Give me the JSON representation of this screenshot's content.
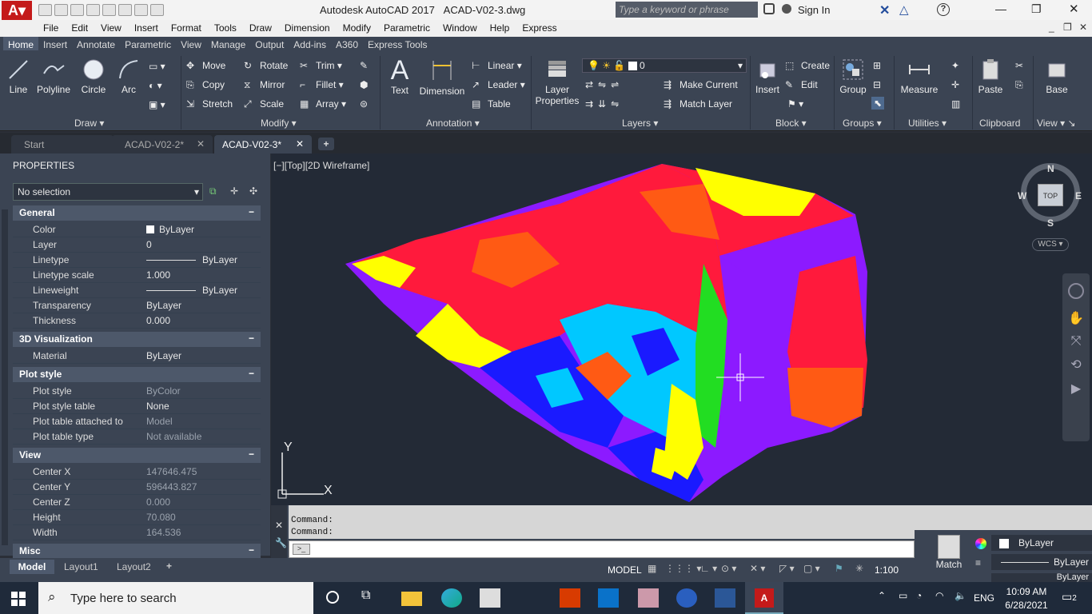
{
  "title": {
    "app": "Autodesk AutoCAD 2017",
    "file": "ACAD-V02-3.dwg",
    "search_placeholder": "Type a keyword or phrase",
    "signin": "Sign In"
  },
  "menu": [
    "File",
    "Edit",
    "View",
    "Insert",
    "Format",
    "Tools",
    "Draw",
    "Dimension",
    "Modify",
    "Parametric",
    "Window",
    "Help",
    "Express"
  ],
  "ribbon_tabs": [
    "Home",
    "Insert",
    "Annotate",
    "Parametric",
    "View",
    "Manage",
    "Output",
    "Add-ins",
    "A360",
    "Express Tools"
  ],
  "draw": {
    "line": "Line",
    "polyline": "Polyline",
    "circle": "Circle",
    "arc": "Arc",
    "panel": "Draw"
  },
  "modify": {
    "move": "Move",
    "rotate": "Rotate",
    "trim": "Trim",
    "copy": "Copy",
    "mirror": "Mirror",
    "fillet": "Fillet",
    "stretch": "Stretch",
    "scale": "Scale",
    "array": "Array",
    "panel": "Modify"
  },
  "annotation": {
    "text": "Text",
    "dimension": "Dimension",
    "linear": "Linear",
    "leader": "Leader",
    "table": "Table",
    "panel": "Annotation"
  },
  "layers": {
    "layer_props": "Layer Properties",
    "current_layer": "0",
    "make_current": "Make Current",
    "match_layer": "Match Layer",
    "panel": "Layers"
  },
  "block": {
    "insert": "Insert",
    "create": "Create",
    "edit": "Edit",
    "panel": "Block"
  },
  "groups": {
    "group": "Group",
    "panel": "Groups"
  },
  "utilities": {
    "measure": "Measure",
    "panel": "Utilities"
  },
  "clipboard": {
    "paste": "Paste",
    "panel": "Clipboard"
  },
  "viewp": {
    "base": "Base",
    "panel": "View"
  },
  "doc_tabs": [
    "Start",
    "ACAD-V02-2*",
    "ACAD-V02-3*"
  ],
  "props": {
    "title": "PROPERTIES",
    "selection": "No selection",
    "general": "General",
    "viz": "3D Visualization",
    "plot": "Plot style",
    "view": "View",
    "misc": "Misc",
    "rows_general": [
      [
        "Color",
        "ByLayer"
      ],
      [
        "Layer",
        "0"
      ],
      [
        "Linetype",
        "ByLayer"
      ],
      [
        "Linetype scale",
        "1.000"
      ],
      [
        "Lineweight",
        "ByLayer"
      ],
      [
        "Transparency",
        "ByLayer"
      ],
      [
        "Thickness",
        "0.000"
      ]
    ],
    "rows_viz": [
      [
        "Material",
        "ByLayer"
      ]
    ],
    "rows_plot": [
      [
        "Plot style",
        "ByColor"
      ],
      [
        "Plot style table",
        "None"
      ],
      [
        "Plot table attached to",
        "Model"
      ],
      [
        "Plot table type",
        "Not available"
      ]
    ],
    "rows_view": [
      [
        "Center X",
        "147646.475"
      ],
      [
        "Center Y",
        "596443.827"
      ],
      [
        "Center Z",
        "0.000"
      ],
      [
        "Height",
        "70.080"
      ],
      [
        "Width",
        "164.536"
      ]
    ]
  },
  "viewport_label": "[−][Top][2D Wireframe]",
  "viewcube": {
    "n": "N",
    "s": "S",
    "e": "E",
    "w": "W",
    "top": "TOP",
    "wcs": "WCS"
  },
  "command": {
    "line1": "Command:",
    "line2": "Command:"
  },
  "layout_tabs": [
    "Model",
    "Layout1",
    "Layout2"
  ],
  "status": {
    "model": "MODEL",
    "scale": "1:100",
    "bylayer1": "ByLayer",
    "bylayer2": "ByLayer",
    "bylayer3": "ByLayer",
    "match": "Match"
  },
  "taskbar": {
    "search": "Type here to search",
    "lang": "ENG",
    "time": "10:09 AM",
    "date": "6/28/2021",
    "notif": "2"
  },
  "colors": {
    "red": "#ff1a3c",
    "orange": "#ff5a14",
    "yellow": "#ffff00",
    "purple": "#8c1aff",
    "blue": "#1a1aff",
    "cyan": "#00c8ff",
    "green": "#22dd22"
  }
}
